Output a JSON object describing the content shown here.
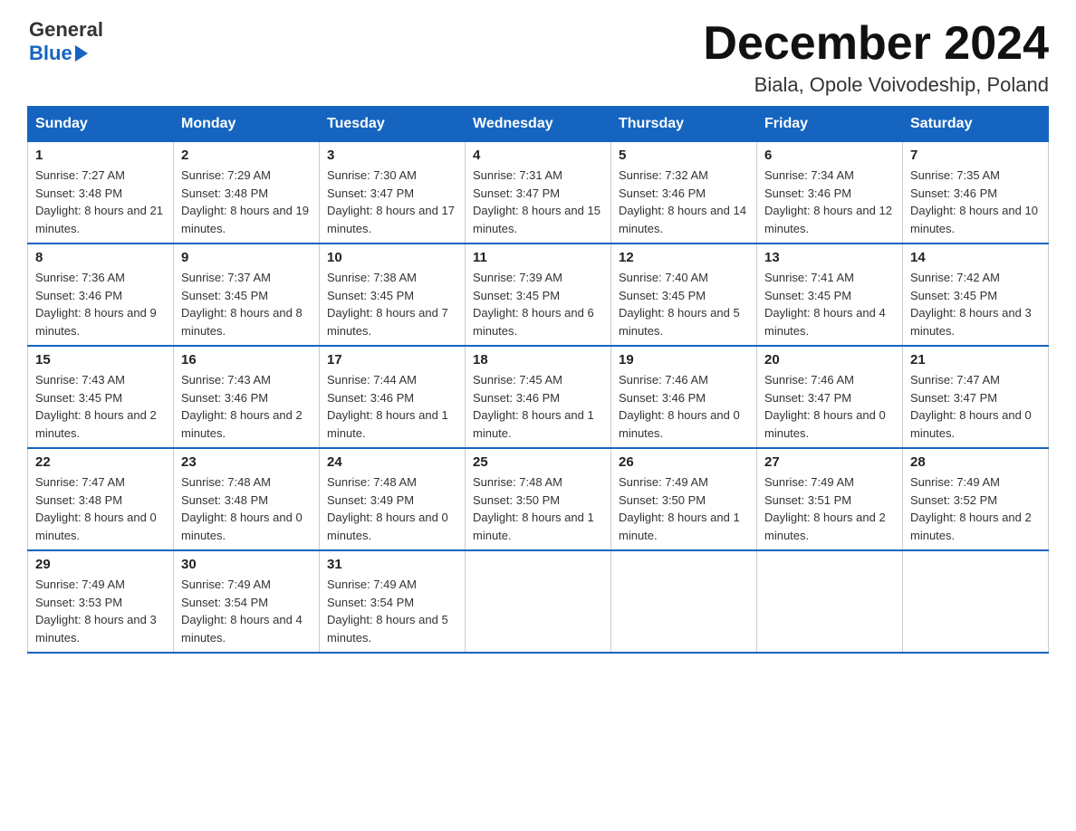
{
  "header": {
    "logo_general": "General",
    "logo_blue": "Blue",
    "title": "December 2024",
    "location": "Biala, Opole Voivodeship, Poland"
  },
  "days_of_week": [
    "Sunday",
    "Monday",
    "Tuesday",
    "Wednesday",
    "Thursday",
    "Friday",
    "Saturday"
  ],
  "weeks": [
    [
      {
        "day": "1",
        "sunrise": "7:27 AM",
        "sunset": "3:48 PM",
        "daylight": "8 hours and 21 minutes."
      },
      {
        "day": "2",
        "sunrise": "7:29 AM",
        "sunset": "3:48 PM",
        "daylight": "8 hours and 19 minutes."
      },
      {
        "day": "3",
        "sunrise": "7:30 AM",
        "sunset": "3:47 PM",
        "daylight": "8 hours and 17 minutes."
      },
      {
        "day": "4",
        "sunrise": "7:31 AM",
        "sunset": "3:47 PM",
        "daylight": "8 hours and 15 minutes."
      },
      {
        "day": "5",
        "sunrise": "7:32 AM",
        "sunset": "3:46 PM",
        "daylight": "8 hours and 14 minutes."
      },
      {
        "day": "6",
        "sunrise": "7:34 AM",
        "sunset": "3:46 PM",
        "daylight": "8 hours and 12 minutes."
      },
      {
        "day": "7",
        "sunrise": "7:35 AM",
        "sunset": "3:46 PM",
        "daylight": "8 hours and 10 minutes."
      }
    ],
    [
      {
        "day": "8",
        "sunrise": "7:36 AM",
        "sunset": "3:46 PM",
        "daylight": "8 hours and 9 minutes."
      },
      {
        "day": "9",
        "sunrise": "7:37 AM",
        "sunset": "3:45 PM",
        "daylight": "8 hours and 8 minutes."
      },
      {
        "day": "10",
        "sunrise": "7:38 AM",
        "sunset": "3:45 PM",
        "daylight": "8 hours and 7 minutes."
      },
      {
        "day": "11",
        "sunrise": "7:39 AM",
        "sunset": "3:45 PM",
        "daylight": "8 hours and 6 minutes."
      },
      {
        "day": "12",
        "sunrise": "7:40 AM",
        "sunset": "3:45 PM",
        "daylight": "8 hours and 5 minutes."
      },
      {
        "day": "13",
        "sunrise": "7:41 AM",
        "sunset": "3:45 PM",
        "daylight": "8 hours and 4 minutes."
      },
      {
        "day": "14",
        "sunrise": "7:42 AM",
        "sunset": "3:45 PM",
        "daylight": "8 hours and 3 minutes."
      }
    ],
    [
      {
        "day": "15",
        "sunrise": "7:43 AM",
        "sunset": "3:45 PM",
        "daylight": "8 hours and 2 minutes."
      },
      {
        "day": "16",
        "sunrise": "7:43 AM",
        "sunset": "3:46 PM",
        "daylight": "8 hours and 2 minutes."
      },
      {
        "day": "17",
        "sunrise": "7:44 AM",
        "sunset": "3:46 PM",
        "daylight": "8 hours and 1 minute."
      },
      {
        "day": "18",
        "sunrise": "7:45 AM",
        "sunset": "3:46 PM",
        "daylight": "8 hours and 1 minute."
      },
      {
        "day": "19",
        "sunrise": "7:46 AM",
        "sunset": "3:46 PM",
        "daylight": "8 hours and 0 minutes."
      },
      {
        "day": "20",
        "sunrise": "7:46 AM",
        "sunset": "3:47 PM",
        "daylight": "8 hours and 0 minutes."
      },
      {
        "day": "21",
        "sunrise": "7:47 AM",
        "sunset": "3:47 PM",
        "daylight": "8 hours and 0 minutes."
      }
    ],
    [
      {
        "day": "22",
        "sunrise": "7:47 AM",
        "sunset": "3:48 PM",
        "daylight": "8 hours and 0 minutes."
      },
      {
        "day": "23",
        "sunrise": "7:48 AM",
        "sunset": "3:48 PM",
        "daylight": "8 hours and 0 minutes."
      },
      {
        "day": "24",
        "sunrise": "7:48 AM",
        "sunset": "3:49 PM",
        "daylight": "8 hours and 0 minutes."
      },
      {
        "day": "25",
        "sunrise": "7:48 AM",
        "sunset": "3:50 PM",
        "daylight": "8 hours and 1 minute."
      },
      {
        "day": "26",
        "sunrise": "7:49 AM",
        "sunset": "3:50 PM",
        "daylight": "8 hours and 1 minute."
      },
      {
        "day": "27",
        "sunrise": "7:49 AM",
        "sunset": "3:51 PM",
        "daylight": "8 hours and 2 minutes."
      },
      {
        "day": "28",
        "sunrise": "7:49 AM",
        "sunset": "3:52 PM",
        "daylight": "8 hours and 2 minutes."
      }
    ],
    [
      {
        "day": "29",
        "sunrise": "7:49 AM",
        "sunset": "3:53 PM",
        "daylight": "8 hours and 3 minutes."
      },
      {
        "day": "30",
        "sunrise": "7:49 AM",
        "sunset": "3:54 PM",
        "daylight": "8 hours and 4 minutes."
      },
      {
        "day": "31",
        "sunrise": "7:49 AM",
        "sunset": "3:54 PM",
        "daylight": "8 hours and 5 minutes."
      },
      null,
      null,
      null,
      null
    ]
  ],
  "labels": {
    "sunrise": "Sunrise:",
    "sunset": "Sunset:",
    "daylight": "Daylight:"
  }
}
